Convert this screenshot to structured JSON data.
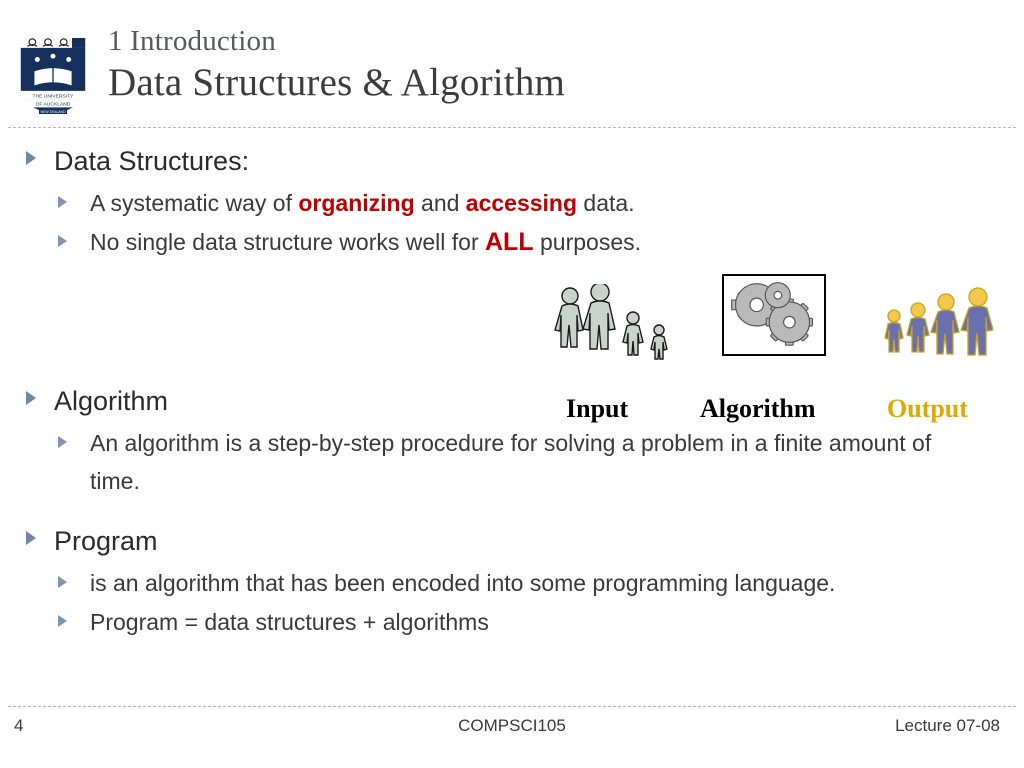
{
  "header": {
    "title_line1": "1 Introduction",
    "title_line2": "Data Structures & Algorithm",
    "logo_alt": "university-of-auckland-crest",
    "logo_text_top": "THE UNIVERSITY OF AUCKLAND",
    "logo_text_bottom": "NEW ZEALAND"
  },
  "sections": {
    "data_structures": {
      "heading": "Data Structures:",
      "sub1_prefix": "A systematic way of ",
      "sub1_bold1": "organizing",
      "sub1_mid": " and ",
      "sub1_bold2": "accessing",
      "sub1_suffix": " data.",
      "sub2_prefix": "No single data structure works well for ",
      "sub2_emphasis": "ALL",
      "sub2_suffix": " purposes."
    },
    "algorithm": {
      "heading": "Algorithm",
      "sub1": "An algorithm is a step-by-step procedure for solving a problem in a finite amount of time."
    },
    "program": {
      "heading": "Program",
      "sub1": "is an algorithm that has been encoded into some programming language.",
      "sub2": "Program = data structures + algorithms"
    }
  },
  "diagram": {
    "caption_input": "Input",
    "caption_algorithm": "Algorithm",
    "caption_output": "Output",
    "input_icon": "group-of-people-grey-icon",
    "process_icon": "gears-box-icon",
    "output_icon": "group-of-people-gold-icon",
    "output_color": "#e0a800"
  },
  "footer": {
    "page_number": "4",
    "course": "COMPSCI105",
    "lecture": "Lecture 07-08"
  }
}
